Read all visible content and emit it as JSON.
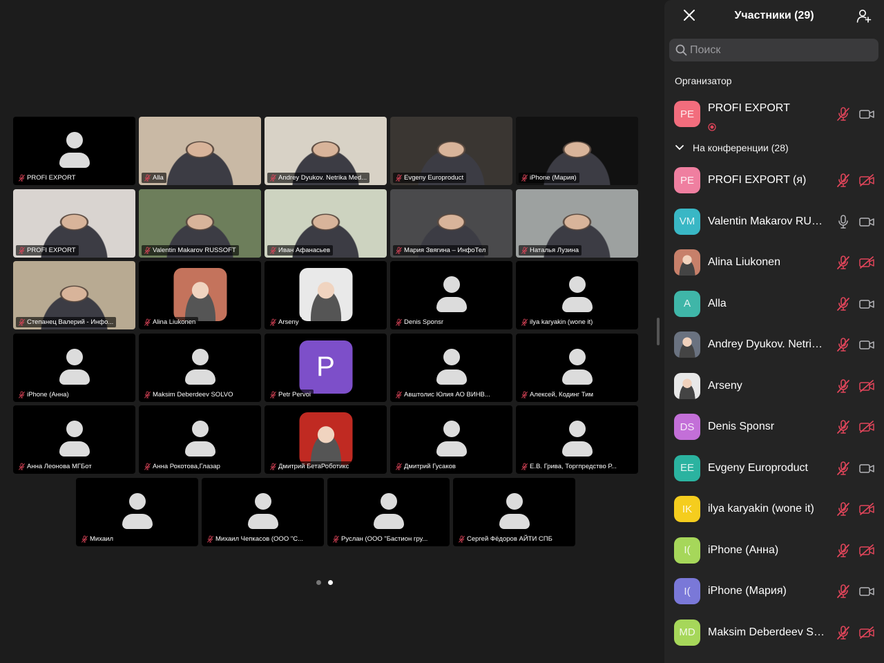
{
  "panel": {
    "title": "Участники (29)",
    "search_placeholder": "Поиск",
    "host_section": "Организатор",
    "conference_section": "На конференции (28)",
    "host": {
      "name": "PROFI EXPORT",
      "initials": "PE",
      "color": "#f26d7d"
    },
    "participants": [
      {
        "name": "PROFI EXPORT (я)",
        "initials": "PE",
        "color": "#ef7fa0"
      },
      {
        "name": "Valentin Makarov RUSSOFT",
        "initials": "VM",
        "color": "#39b7c5"
      },
      {
        "name": "Alina Liukonen",
        "initials": "",
        "color": "#c7806a",
        "photo": true
      },
      {
        "name": "Alla",
        "initials": "A",
        "color": "#3fb6a8"
      },
      {
        "name": "Andrey Dyukov. Netrika Medicine",
        "initials": "",
        "color": "#6a7280",
        "photo": true
      },
      {
        "name": "Arseny",
        "initials": "",
        "color": "#e8e8e8",
        "photo": true
      },
      {
        "name": "Denis Sponsr",
        "initials": "DS",
        "color": "#c36fd8"
      },
      {
        "name": "Evgeny Europroduct",
        "initials": "EE",
        "color": "#2bb3a0"
      },
      {
        "name": "ilya karyakin (wone it)",
        "initials": "IK",
        "color": "#f5cd1e"
      },
      {
        "name": "iPhone (Анна)",
        "initials": "I(",
        "color": "#a6d75a"
      },
      {
        "name": "iPhone (Мария)",
        "initials": "I(",
        "color": "#7a78d8"
      },
      {
        "name": "Maksim Deberdeev SOLVO",
        "initials": "MD",
        "color": "#a6d75a"
      }
    ]
  },
  "tiles": [
    {
      "label": "PROFI EXPORT",
      "type": "avatar"
    },
    {
      "label": "Alla",
      "type": "video",
      "bg": "#c9b9a5"
    },
    {
      "label": "Andrey Dyukov. Netrika Med...",
      "type": "video",
      "bg": "#d8d2c6"
    },
    {
      "label": "Evgeny Europroduct",
      "type": "video",
      "bg": "#3a3632"
    },
    {
      "label": "iPhone (Мария)",
      "type": "video",
      "bg": "#111111"
    },
    {
      "label": "PROFI EXPORT",
      "type": "video",
      "bg": "#d9d4d0"
    },
    {
      "label": "Valentin Makarov RUSSOFT",
      "type": "video",
      "bg": "#6d7e5b",
      "active": true
    },
    {
      "label": "Иван Афанасьев",
      "type": "video",
      "bg": "#cdd3c0"
    },
    {
      "label": "Мария Звягина – ИнфоТел",
      "type": "video",
      "bg": "#4a4a4c"
    },
    {
      "label": "Наталья Лузина",
      "type": "video",
      "bg": "#9da1a0"
    },
    {
      "label": "Степанец Валерий - Инфо...",
      "type": "video",
      "bg": "#b8aa92"
    },
    {
      "label": "Alina Liukonen",
      "type": "photo",
      "bg": "#c4735c"
    },
    {
      "label": "Arseny",
      "type": "photo",
      "bg": "#e9e9e9"
    },
    {
      "label": "Denis Sponsr",
      "type": "avatar"
    },
    {
      "label": "ilya karyakin (wone it)",
      "type": "avatar"
    },
    {
      "label": "iPhone (Анна)",
      "type": "avatar"
    },
    {
      "label": "Maksim Deberdeev SOLVO",
      "type": "avatar"
    },
    {
      "label": "Petr Pervoi",
      "type": "initial",
      "initial": "P"
    },
    {
      "label": "Авштолис Юлия АО ВИНВ...",
      "type": "avatar"
    },
    {
      "label": "Алексей, Кодинг Тим",
      "type": "avatar"
    },
    {
      "label": "Анна Леонова МГБот",
      "type": "avatar"
    },
    {
      "label": "Анна Рокотова,Глазар",
      "type": "avatar"
    },
    {
      "label": "Дмитрий БетаРоботикс",
      "type": "photo",
      "bg": "#c02a22"
    },
    {
      "label": "Дмитрий Гусаков",
      "type": "avatar"
    },
    {
      "label": "Е.В. Грива, Торгпредство Р...",
      "type": "avatar"
    },
    {
      "label": "Михаил",
      "type": "avatar"
    },
    {
      "label": "Михаил Чепкасов (ООО \"С...",
      "type": "avatar"
    },
    {
      "label": "Руслан (ООО \"Бастион гру...",
      "type": "avatar"
    },
    {
      "label": "Сергей Фёдоров АЙТИ СПБ",
      "type": "avatar"
    }
  ],
  "pagination": {
    "pages": 2,
    "current": 2
  },
  "colors": {
    "muted": "#e0455a",
    "active_speaker": "#3fd06a",
    "panel_bg": "#242424"
  }
}
